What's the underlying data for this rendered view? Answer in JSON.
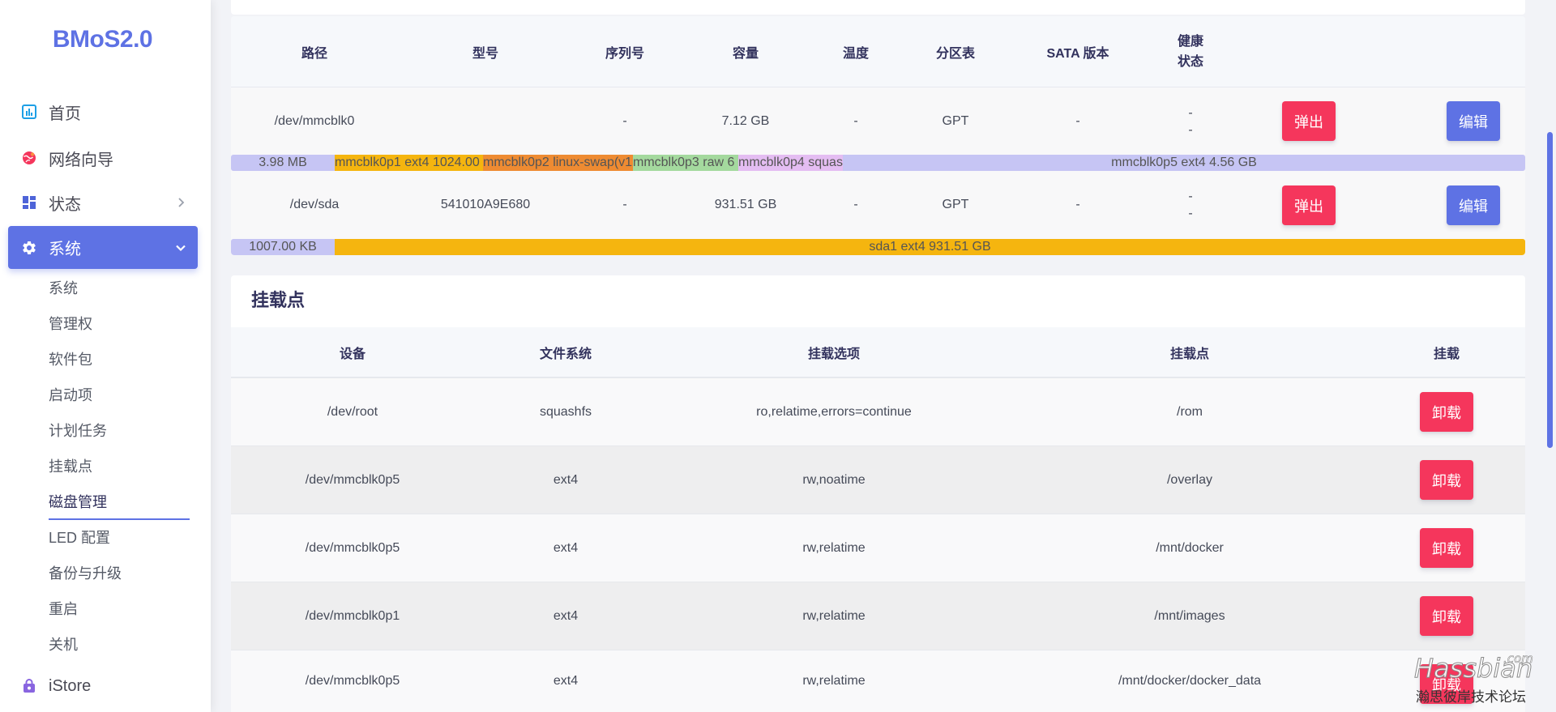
{
  "app": {
    "logo": "BMoS2.0"
  },
  "theme": {
    "accent": "#5e72e4",
    "danger": "#f5365c"
  },
  "sidebar": {
    "items": [
      {
        "label": "首页",
        "icon": "chart-icon"
      },
      {
        "label": "网络向导",
        "icon": "globe-icon"
      },
      {
        "label": "状态",
        "icon": "grid-icon"
      },
      {
        "label": "系统",
        "icon": "gear-icon",
        "active": true
      }
    ],
    "submenu": [
      {
        "label": "系统"
      },
      {
        "label": "管理权"
      },
      {
        "label": "软件包"
      },
      {
        "label": "启动项"
      },
      {
        "label": "计划任务"
      },
      {
        "label": "挂载点"
      },
      {
        "label": "磁盘管理",
        "active": true
      },
      {
        "label": "LED 配置"
      },
      {
        "label": "备份与升级"
      },
      {
        "label": "重启"
      },
      {
        "label": "关机"
      }
    ],
    "footer_item": {
      "label": "iStore",
      "icon": "bag-icon"
    }
  },
  "disks": {
    "headers": {
      "path": "路径",
      "model": "型号",
      "serial": "序列号",
      "capacity": "容量",
      "temp": "温度",
      "partition_table": "分区表",
      "sata": "SATA 版本",
      "health": [
        "健康",
        "状态"
      ]
    },
    "rows": [
      {
        "path": "/dev/mmcblk0",
        "model": "",
        "serial": "-",
        "capacity": "7.12 GB",
        "temp": "-",
        "partition_table": "GPT",
        "sata": "-",
        "health": [
          "-",
          "-"
        ],
        "eject": "弹出",
        "edit": "编辑",
        "partitions": [
          {
            "label": "3.98 MB",
            "color": "#c6c5f4"
          },
          {
            "label": "mmcblk0p1 ext4 1024.00",
            "color": "#f5b50f"
          },
          {
            "label": "mmcblk0p2 linux-swap(v1",
            "color": "#ee8b32"
          },
          {
            "label": "mmcblk0p3 raw 6",
            "color": "#a4d99e"
          },
          {
            "label": "mmcblk0p4 squas",
            "color": "#e4bdf2"
          },
          {
            "label": "mmcblk0p5 ext4 4.56 GB",
            "color": "#c6c5f4"
          }
        ]
      },
      {
        "path": "/dev/sda",
        "model": "541010A9E680",
        "serial": "-",
        "capacity": "931.51 GB",
        "temp": "-",
        "partition_table": "GPT",
        "sata": "-",
        "health": [
          "-",
          "-"
        ],
        "eject": "弹出",
        "edit": "编辑",
        "partitions": [
          {
            "label": "1007.00 KB",
            "color": "#c6c5f4"
          },
          {
            "label": "sda1 ext4 931.51 GB",
            "color": "#f5b50f"
          }
        ]
      }
    ]
  },
  "mounts": {
    "title": "挂载点",
    "headers": {
      "device": "设备",
      "fs": "文件系统",
      "options": "挂载选项",
      "mountpoint": "挂载点",
      "action": "挂载"
    },
    "rows": [
      {
        "device": "/dev/root",
        "fs": "squashfs",
        "options": "ro,relatime,errors=continue",
        "mountpoint": "/rom",
        "action": "卸载"
      },
      {
        "device": "/dev/mmcblk0p5",
        "fs": "ext4",
        "options": "rw,noatime",
        "mountpoint": "/overlay",
        "action": "卸载"
      },
      {
        "device": "/dev/mmcblk0p5",
        "fs": "ext4",
        "options": "rw,relatime",
        "mountpoint": "/mnt/docker",
        "action": "卸载"
      },
      {
        "device": "/dev/mmcblk0p1",
        "fs": "ext4",
        "options": "rw,relatime",
        "mountpoint": "/mnt/images",
        "action": "卸载"
      },
      {
        "device": "/dev/mmcblk0p5",
        "fs": "ext4",
        "options": "rw,relatime",
        "mountpoint": "/mnt/docker/docker_data",
        "action": "卸载"
      }
    ]
  },
  "watermark": {
    "main": "Hassbian",
    "suffix": ".com",
    "sub": "瀚思彼岸技术论坛"
  }
}
